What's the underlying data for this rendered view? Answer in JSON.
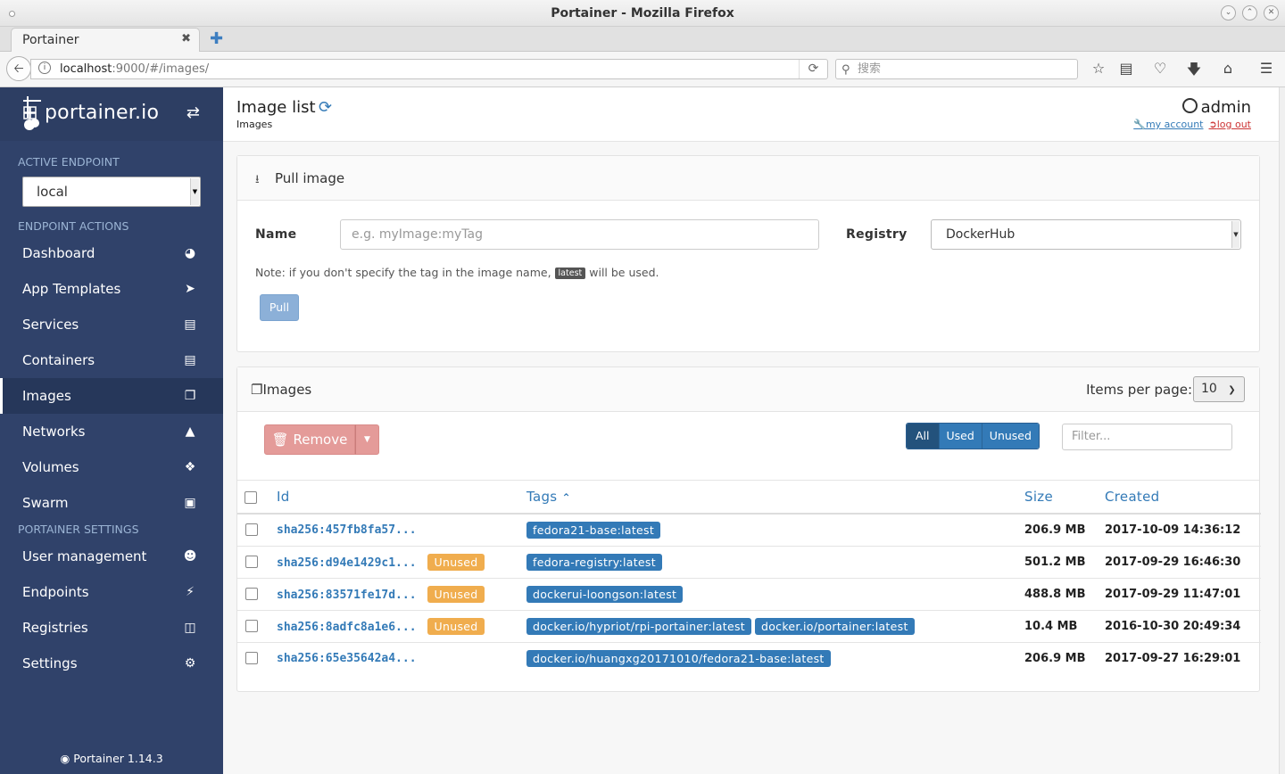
{
  "window": {
    "title": "Portainer - Mozilla Firefox"
  },
  "browser": {
    "tab_label": "Portainer",
    "url_host": "localhost",
    "url_path": ":9000/#/images/",
    "search_placeholder": "搜索"
  },
  "sidebar": {
    "brand": "portainer.io",
    "active_endpoint_title": "ACTIVE ENDPOINT",
    "endpoint_value": "local",
    "endpoint_actions_title": "ENDPOINT ACTIONS",
    "items": [
      {
        "label": "Dashboard",
        "icon": "tachometer-icon"
      },
      {
        "label": "App Templates",
        "icon": "rocket-icon"
      },
      {
        "label": "Services",
        "icon": "list-alt-icon"
      },
      {
        "label": "Containers",
        "icon": "server-icon"
      },
      {
        "label": "Images",
        "icon": "clone-icon"
      },
      {
        "label": "Networks",
        "icon": "sitemap-icon"
      },
      {
        "label": "Volumes",
        "icon": "cubes-icon"
      },
      {
        "label": "Swarm",
        "icon": "object-group-icon"
      }
    ],
    "settings_title": "PORTAINER SETTINGS",
    "settings_items": [
      {
        "label": "User management",
        "icon": "users-icon"
      },
      {
        "label": "Endpoints",
        "icon": "plug-icon"
      },
      {
        "label": "Registries",
        "icon": "database-icon"
      },
      {
        "label": "Settings",
        "icon": "cogs-icon"
      }
    ],
    "footer": "Portainer 1.14.3"
  },
  "header": {
    "title": "Image list",
    "breadcrumb": "Images",
    "user": "admin",
    "my_account": "my account",
    "log_out": "log out"
  },
  "pull": {
    "title": "Pull image",
    "name_label": "Name",
    "name_placeholder": "e.g. myImage:myTag",
    "registry_label": "Registry",
    "registry_value": "DockerHub",
    "note_before": "Note: if you don't specify the tag in the image name,",
    "note_code": "latest",
    "note_after": "will be used.",
    "button": "Pull"
  },
  "images": {
    "title": "Images",
    "items_per_page_label": "Items per page:",
    "items_per_page": "10",
    "remove_label": "Remove",
    "filters": [
      "All",
      "Used",
      "Unused"
    ],
    "filter_placeholder": "Filter...",
    "columns": {
      "id": "Id",
      "tags": "Tags",
      "size": "Size",
      "created": "Created"
    },
    "rows": [
      {
        "id": "sha256:457fb8fa57...",
        "unused": "",
        "tags": [
          "fedora21-base:latest"
        ],
        "size": "206.9 MB",
        "created": "2017-10-09 14:36:12"
      },
      {
        "id": "sha256:d94e1429c1...",
        "unused": "Unused",
        "tags": [
          "fedora-registry:latest"
        ],
        "size": "501.2 MB",
        "created": "2017-09-29 16:46:30"
      },
      {
        "id": "sha256:83571fe17d...",
        "unused": "Unused",
        "tags": [
          "dockerui-loongson:latest"
        ],
        "size": "488.8 MB",
        "created": "2017-09-29 11:47:01"
      },
      {
        "id": "sha256:8adfc8a1e6...",
        "unused": "Unused",
        "tags": [
          "docker.io/hypriot/rpi-portainer:latest",
          "docker.io/portainer:latest"
        ],
        "size": "10.4 MB",
        "created": "2016-10-30 20:49:34"
      },
      {
        "id": "sha256:65e35642a4...",
        "unused": "",
        "tags": [
          "docker.io/huangxg20171010/fedora21-base:latest"
        ],
        "size": "206.9 MB",
        "created": "2017-09-27 16:29:01"
      }
    ]
  },
  "colors": {
    "sidebar": "#30426a",
    "accent": "#337ab7",
    "unused": "#f0ad4e",
    "remove": "#e49b99"
  }
}
